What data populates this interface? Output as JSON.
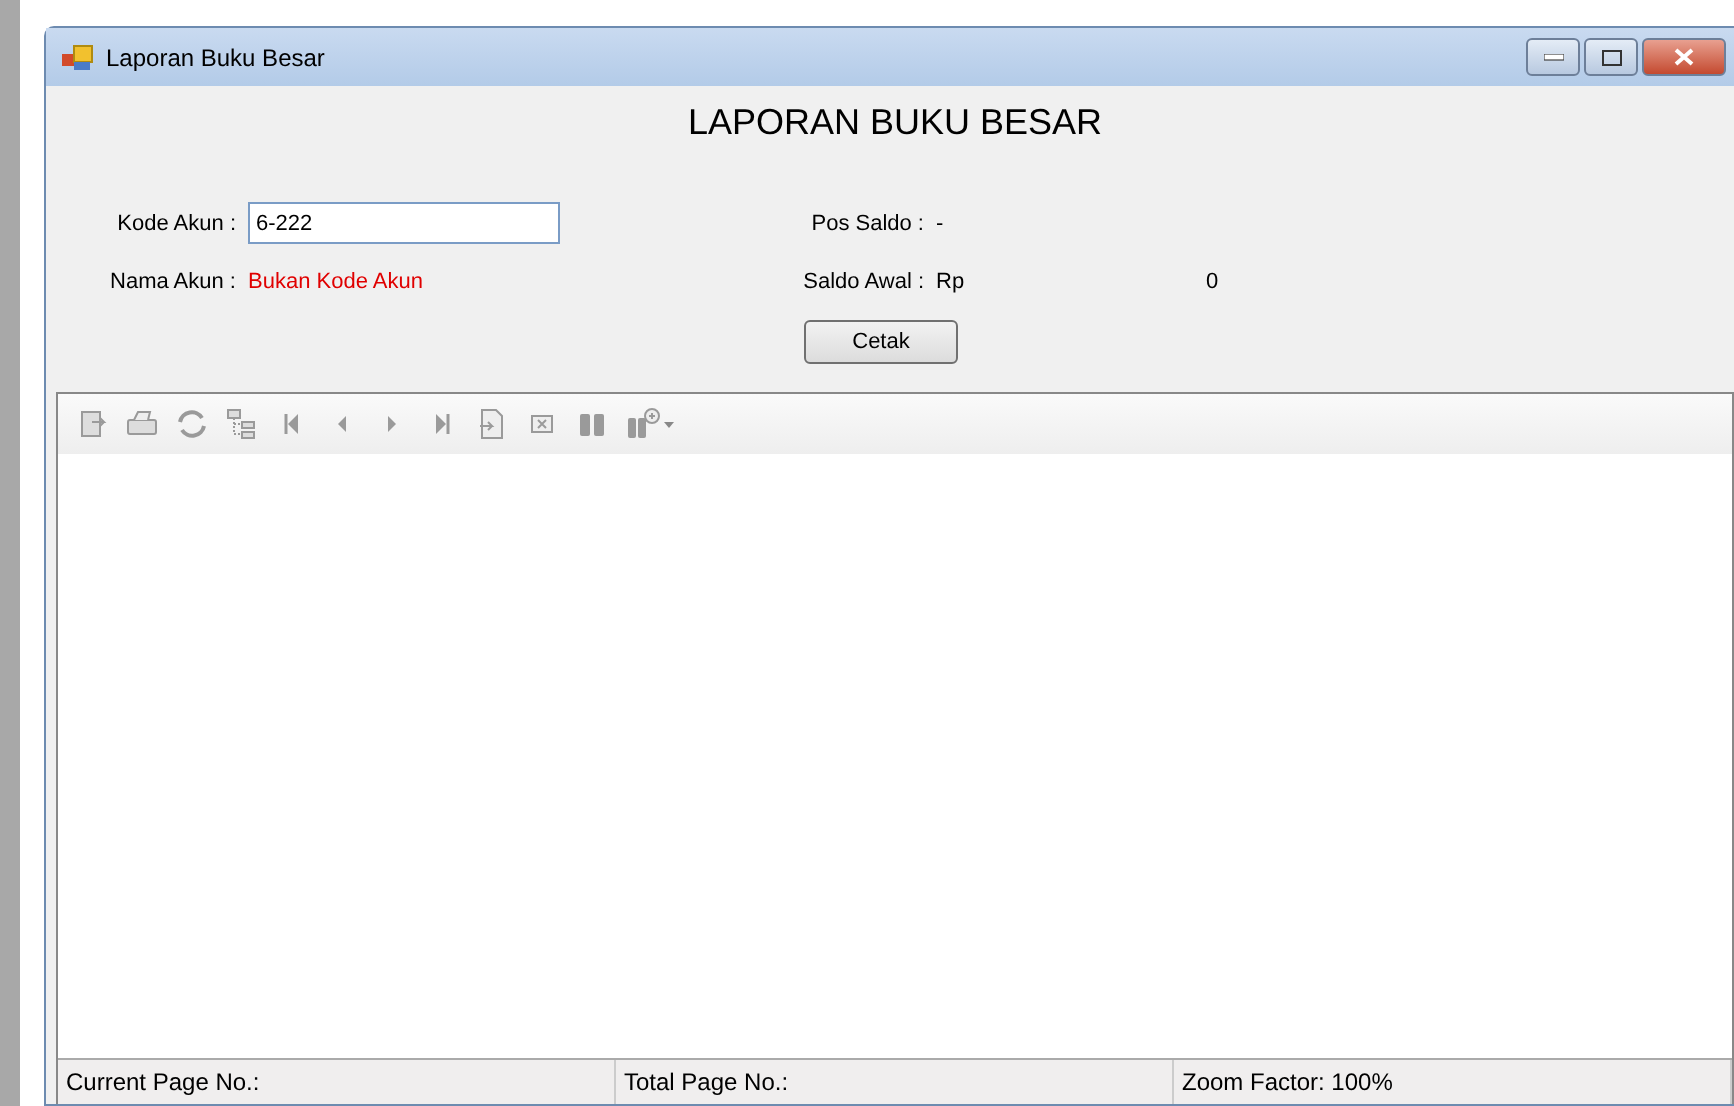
{
  "window": {
    "title": "Laporan Buku Besar"
  },
  "heading": "LAPORAN BUKU BESAR",
  "form": {
    "kode_akun": {
      "label": "Kode Akun :",
      "value": "6-222"
    },
    "nama_akun": {
      "label": "Nama Akun :",
      "value": "Bukan Kode Akun"
    },
    "pos_saldo": {
      "label": "Pos Saldo :",
      "value": "-"
    },
    "saldo_awal": {
      "label": "Saldo Awal :",
      "currency": "Rp",
      "value": "0"
    },
    "button": "Cetak"
  },
  "status_bar": [
    "Current Page No.:",
    "Total Page No.:",
    "Zoom Factor: 100%"
  ]
}
